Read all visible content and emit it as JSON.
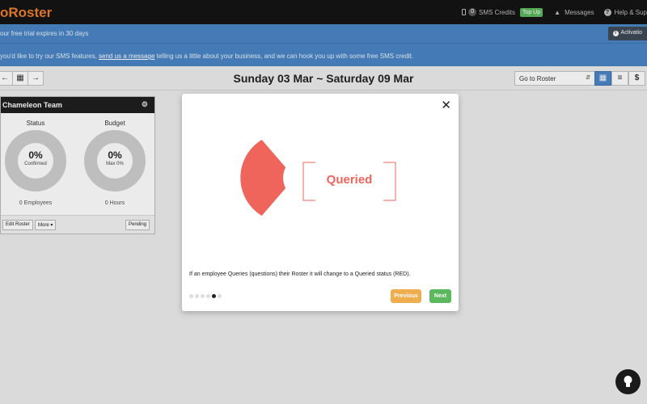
{
  "app": {
    "logo_text": "oRoster"
  },
  "topnav": {
    "sms_credit_count": "0",
    "sms_credits_label": "SMS Credits",
    "topup_label": "Top Up",
    "messages_label": "Messages",
    "help_label": "Help & Sup"
  },
  "banners": {
    "trial_text": "our free trial expires in 30 days",
    "activation_label": "Activatio",
    "sms_prefix": "you'd like to try our SMS features, ",
    "sms_link": "send us a message",
    "sms_suffix": " telling us a little about your business, and we can hook you up with some free SMS credit."
  },
  "toolbar": {
    "week_title": "Sunday 03 Mar ~ Saturday 09 Mar",
    "goto_label": "Go to Roster",
    "dollar_label": "$"
  },
  "team_panel": {
    "title": "Chameleon Team",
    "status": {
      "label": "Status",
      "value": "0%",
      "sub": "Confirmed",
      "footer": "0 Employees"
    },
    "budget": {
      "label": "Budget",
      "value": "0%",
      "sub": "Max 0%",
      "footer": "0 Hours"
    },
    "edit_roster_label": "Edit Roster",
    "more_label": "More ▾",
    "pending_label": "Pending"
  },
  "modal": {
    "queried_label": "Queried",
    "description": "If an employee Queries (questions) their Roster it will change to a Queried status (RED).",
    "previous_label": "Previous",
    "next_label": "Next",
    "total_steps": 6,
    "current_step": 5
  },
  "colors": {
    "queried_red": "#ef655c",
    "brand_orange": "#f07f2b",
    "banner_blue": "#4a86c6",
    "previous_orange": "#f0ad4e",
    "next_green": "#5cb85c"
  },
  "icons": [
    "phone-icon",
    "bell-icon",
    "help-icon",
    "info-icon",
    "arrow-left-icon",
    "calendar-icon",
    "arrow-right-icon",
    "grid-view-icon",
    "list-view-icon",
    "gear-icon",
    "close-icon",
    "lightbulb-icon"
  ]
}
